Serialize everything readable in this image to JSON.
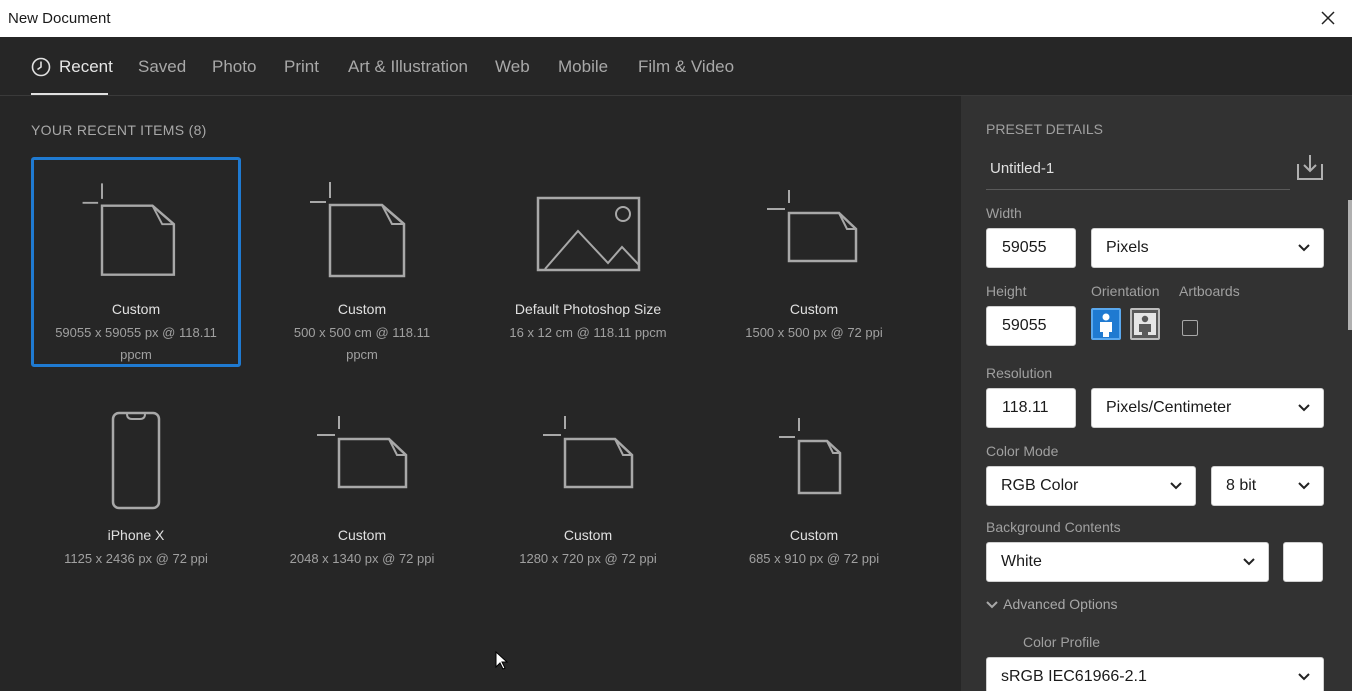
{
  "window": {
    "title": "New Document",
    "close_icon": "close-icon"
  },
  "tabs": [
    {
      "label": "Recent",
      "active": true
    },
    {
      "label": "Saved"
    },
    {
      "label": "Photo"
    },
    {
      "label": "Print"
    },
    {
      "label": "Art & Illustration"
    },
    {
      "label": "Web"
    },
    {
      "label": "Mobile"
    },
    {
      "label": "Film & Video"
    }
  ],
  "recent": {
    "heading": "YOUR RECENT ITEMS",
    "count": "(8)",
    "items": [
      {
        "name": "Custom",
        "dims": "59055 x 59055 px @ 118.11 ppcm",
        "icon": "document-square-icon",
        "selected": true
      },
      {
        "name": "Custom",
        "dims": "500 x 500 cm @ 118.11 ppcm",
        "icon": "document-square-icon"
      },
      {
        "name": "Default Photoshop Size",
        "dims": "16 x 12 cm @ 118.11 ppcm",
        "icon": "image-icon"
      },
      {
        "name": "Custom",
        "dims": "1500 x 500 px @ 72 ppi",
        "icon": "document-landscape-icon"
      },
      {
        "name": "iPhone X",
        "dims": "1125 x 2436 px @ 72 ppi",
        "icon": "phone-icon"
      },
      {
        "name": "Custom",
        "dims": "2048 x 1340 px @ 72 ppi",
        "icon": "document-landscape-icon"
      },
      {
        "name": "Custom",
        "dims": "1280 x 720 px @ 72 ppi",
        "icon": "document-landscape-icon"
      },
      {
        "name": "Custom",
        "dims": "685 x 910 px @ 72 ppi",
        "icon": "document-portrait-icon"
      }
    ]
  },
  "preset": {
    "heading": "PRESET DETAILS",
    "name": "Untitled-1",
    "width_label": "Width",
    "width_value": "59055",
    "width_unit": "Pixels",
    "height_label": "Height",
    "height_value": "59055",
    "orientation_label": "Orientation",
    "artboards_label": "Artboards",
    "resolution_label": "Resolution",
    "resolution_value": "118.11",
    "resolution_unit": "Pixels/Centimeter",
    "color_mode_label": "Color Mode",
    "color_mode": "RGB Color",
    "bit_depth": "8 bit",
    "background_label": "Background Contents",
    "background": "White",
    "background_swatch": "#ffffff",
    "advanced_label": "Advanced Options",
    "color_profile_label": "Color Profile",
    "color_profile": "sRGB IEC61966-2.1"
  },
  "colors": {
    "accent": "#1f7ad1",
    "panel": "#262626",
    "side_panel": "#323232"
  }
}
